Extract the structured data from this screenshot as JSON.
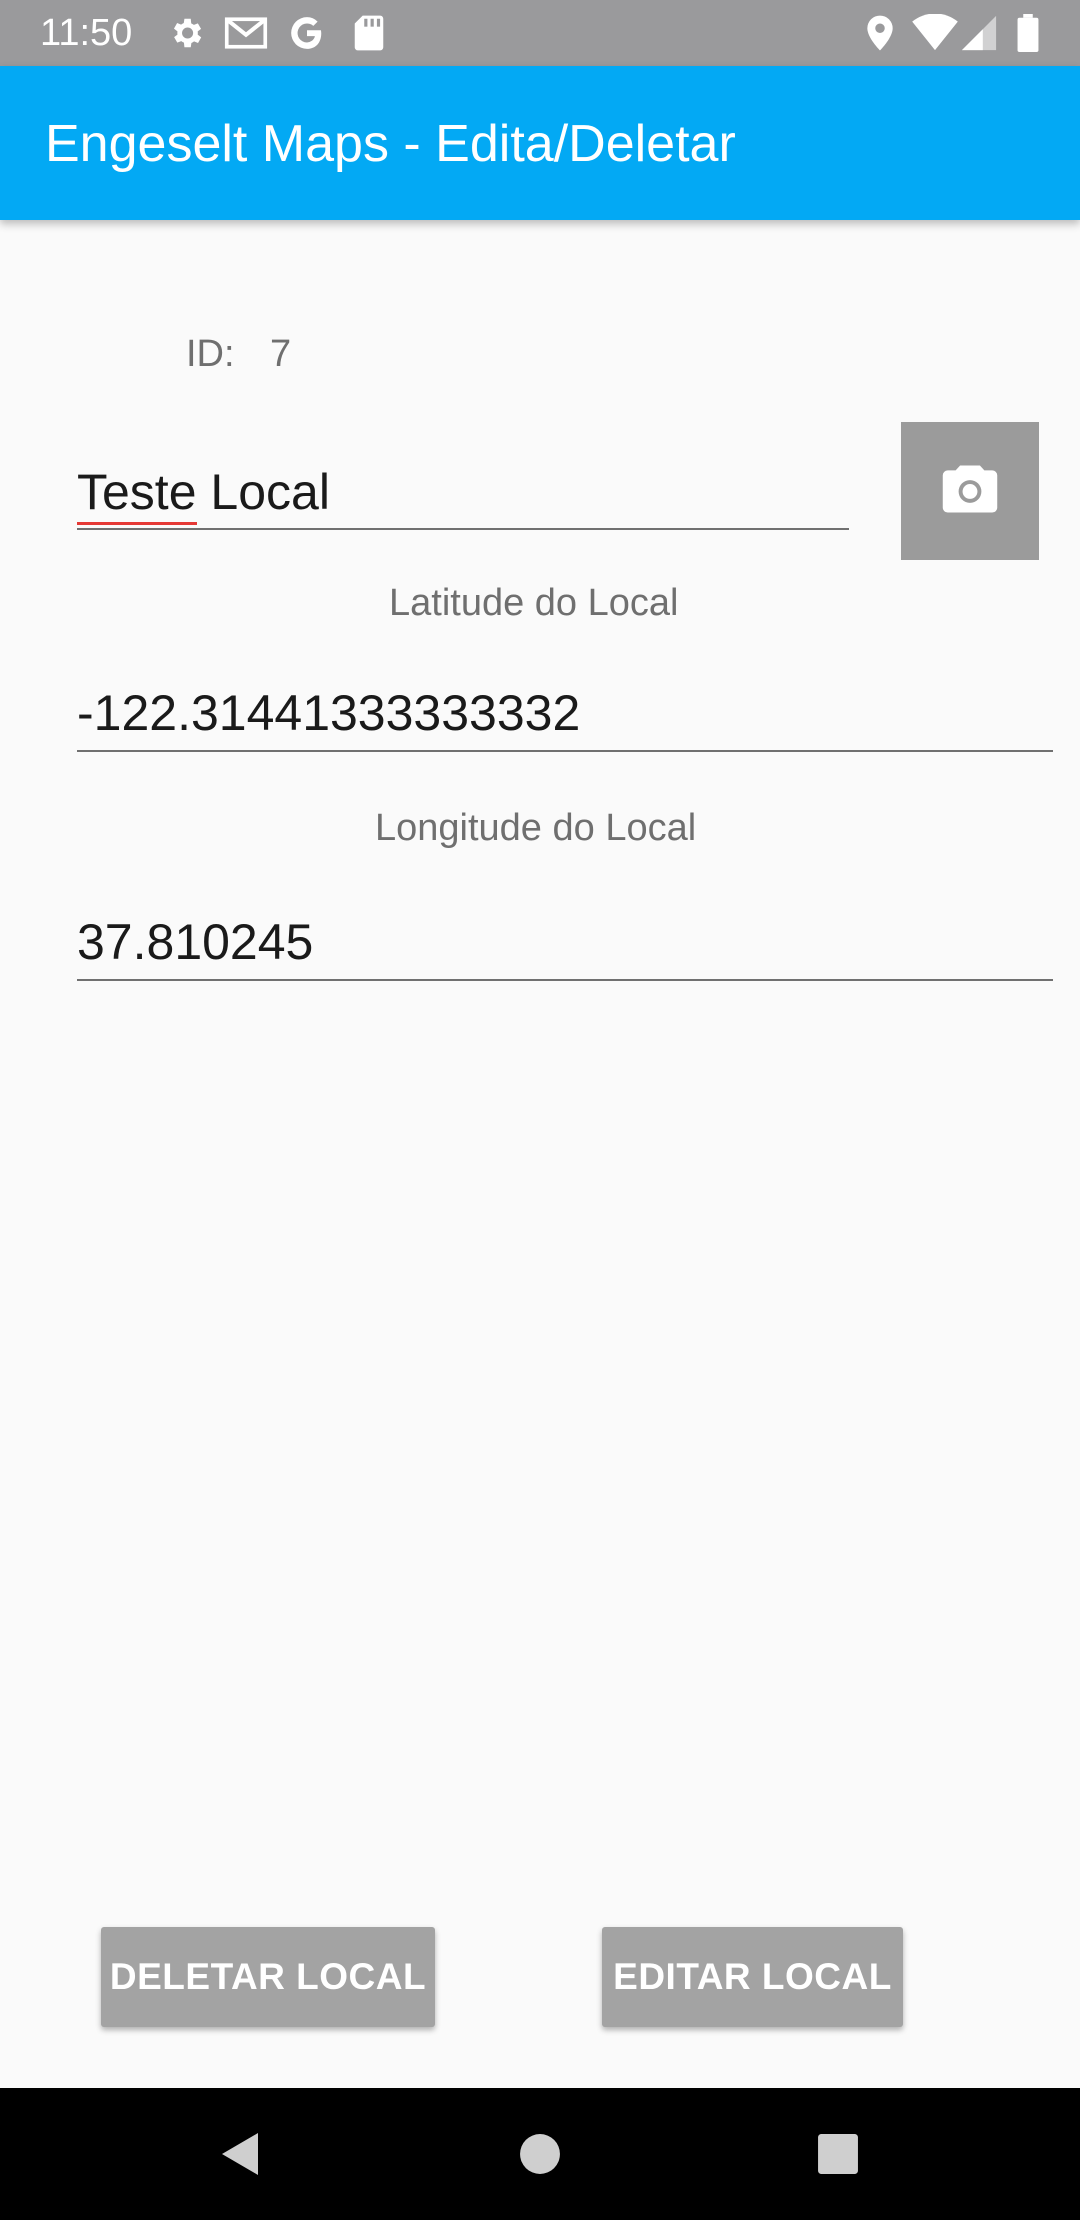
{
  "status_bar": {
    "time": "11:50",
    "left_icons": [
      "gear-icon",
      "gmail-icon",
      "google-icon",
      "sd-card-icon"
    ],
    "right_icons": [
      "location-pin-icon",
      "wifi-icon",
      "signal-icon",
      "battery-icon"
    ]
  },
  "app_bar": {
    "title": "Engeselt Maps - Edita/Deletar",
    "color": "#03a9f4"
  },
  "form": {
    "id_label": "ID:",
    "id_value": "7",
    "name_value_misspelled_part": "Teste",
    "name_value_rest": " Local",
    "latitude_caption": "Latitude do Local",
    "latitude_value": "-122.31441333333332",
    "longitude_caption": "Longitude do Local",
    "longitude_value": "37.810245",
    "camera_icon": "camera-icon"
  },
  "actions": {
    "delete_label": "DELETAR LOCAL",
    "edit_label": "EDITAR LOCAL"
  },
  "nav_bar": {
    "icons": [
      "back-icon",
      "home-icon",
      "recents-icon"
    ]
  }
}
